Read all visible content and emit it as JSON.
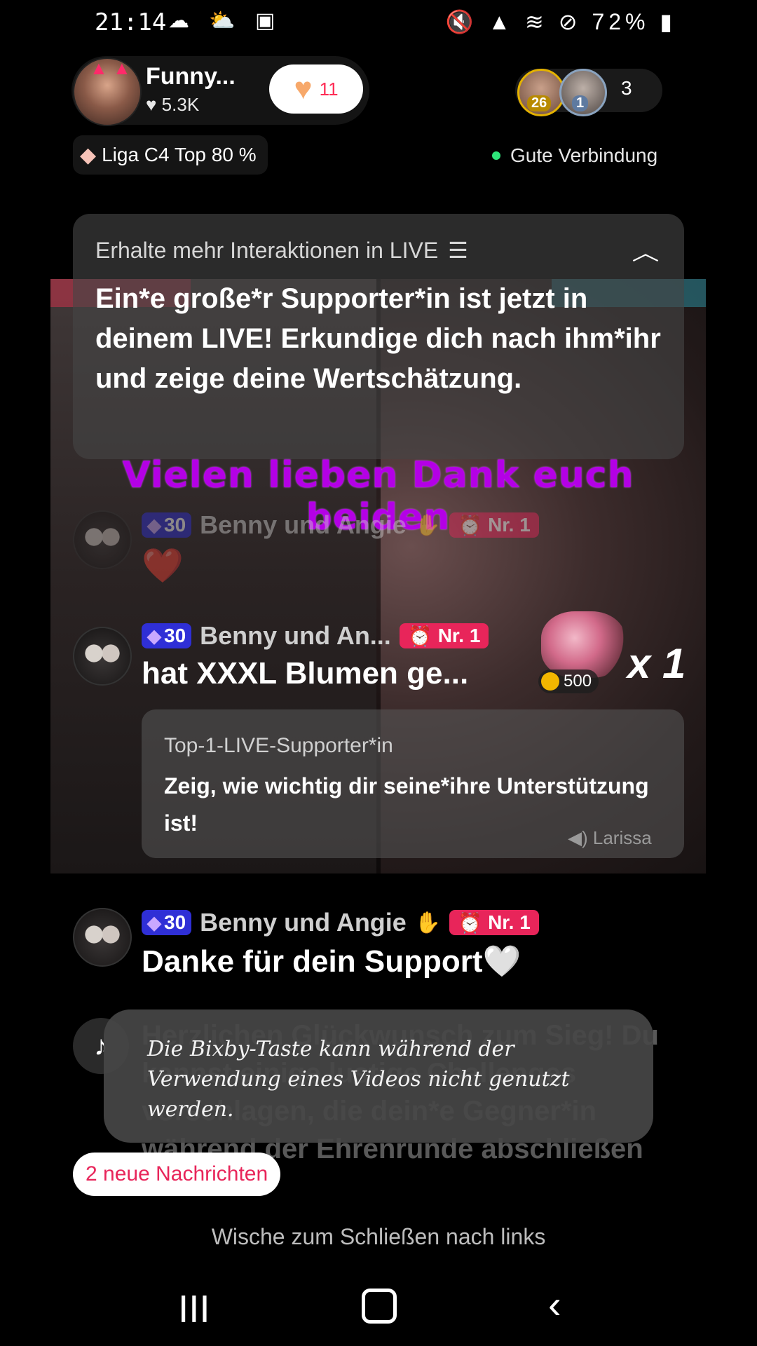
{
  "status_bar": {
    "time": "21:14",
    "left_icons": "☁ ⛅ ▣",
    "battery": "72%",
    "right_icons": "🔇 ▲ ≋ ⊘"
  },
  "host": {
    "name": "Funny...",
    "likes": "5.3K",
    "follow_count": "11"
  },
  "viewers": {
    "badge1": "26",
    "badge2": "1",
    "count": "3"
  },
  "league": {
    "label": "Liga C4 Top 80 %"
  },
  "connection": {
    "label": "Gute Verbindung"
  },
  "interaction_card": {
    "title": "Erhalte mehr Interaktionen in LIVE",
    "body": "Ein*e große*r Supporter*in ist jetzt in deinem LIVE! Erkundige dich nach ihm*ihr und zeige deine Wertschätzung."
  },
  "banner": {
    "text": "Vielen lieben Dank euch beiden"
  },
  "comments": [
    {
      "level": "30",
      "user": "Benny und Angie",
      "rank": "Nr. 1",
      "text": "❤️"
    },
    {
      "level": "30",
      "user": "Benny und An...",
      "rank": "Nr. 1",
      "text": "hat XXXL Blumen  ge...",
      "gift_coins": "500",
      "gift_multiplier": "x 1"
    },
    {
      "level": "30",
      "user": "Benny und Angie",
      "rank": "Nr. 1",
      "text": "Danke für dein Support🤍"
    }
  ],
  "support_card": {
    "title": "Top-1-LIVE-Supporter*in",
    "body": "Zeig, wie wichtig dir seine*ihre Unterstützung ist!",
    "voice": "Larissa"
  },
  "faded_message": {
    "text": "Herzlichen Glückwunsch zum Sieg! Du kannst einige lustige Challenges vorschlagen, die dein*e Gegner*in während der Ehrenrunde abschließen"
  },
  "toast": {
    "text": "Die Bixby-Taste kann während der Verwendung eines Videos nicht genutzt werden."
  },
  "new_messages": {
    "label": "2 neue Nachrichten"
  },
  "swipe_hint": {
    "label": "Wische zum Schließen nach links"
  }
}
